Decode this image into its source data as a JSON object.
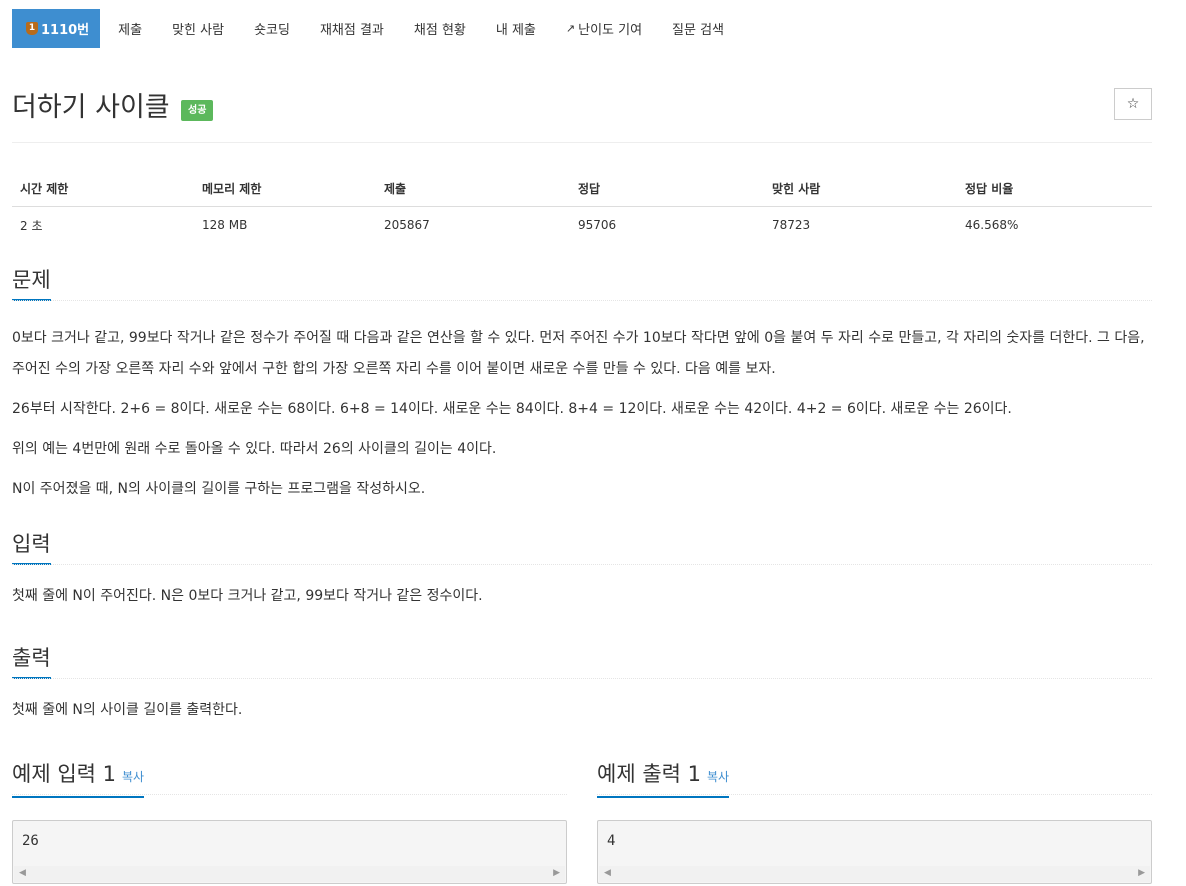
{
  "nav": {
    "problem_num": "1110번",
    "problem_badge_icon": "trophy-icon",
    "items": [
      "제출",
      "맞힌 사람",
      "숏코딩",
      "재채점 결과",
      "채점 현황",
      "내 제출",
      "난이도 기여",
      "질문 검색"
    ]
  },
  "problem": {
    "title": "더하기 사이클",
    "status_badge": "성공",
    "star": "☆"
  },
  "info": {
    "headers": [
      "시간 제한",
      "메모리 제한",
      "제출",
      "정답",
      "맞힌 사람",
      "정답 비율"
    ],
    "values": [
      "2 초",
      "128 MB",
      "205867",
      "95706",
      "78723",
      "46.568%"
    ]
  },
  "sections": {
    "description": {
      "heading": "문제",
      "paragraphs": [
        "0보다 크거나 같고, 99보다 작거나 같은 정수가 주어질 때 다음과 같은 연산을 할 수 있다. 먼저 주어진 수가 10보다 작다면 앞에 0을 붙여 두 자리 수로 만들고, 각 자리의 숫자를 더한다. 그 다음, 주어진 수의 가장 오른쪽 자리 수와 앞에서 구한 합의 가장 오른쪽 자리 수를 이어 붙이면 새로운 수를 만들 수 있다. 다음 예를 보자.",
        "26부터 시작한다. 2+6 = 8이다. 새로운 수는 68이다. 6+8 = 14이다. 새로운 수는 84이다. 8+4 = 12이다. 새로운 수는 42이다. 4+2 = 6이다. 새로운 수는 26이다.",
        "위의 예는 4번만에 원래 수로 돌아올 수 있다. 따라서 26의 사이클의 길이는 4이다.",
        "N이 주어졌을 때, N의 사이클의 길이를 구하는 프로그램을 작성하시오."
      ]
    },
    "input": {
      "heading": "입력",
      "text": "첫째 줄에 N이 주어진다. N은 0보다 크거나 같고, 99보다 작거나 같은 정수이다."
    },
    "output": {
      "heading": "출력",
      "text": "첫째 줄에 N의 사이클 길이를 출력한다."
    }
  },
  "samples": {
    "input": {
      "heading": "예제 입력 1",
      "copy": "복사",
      "content": "26"
    },
    "output": {
      "heading": "예제 출력 1",
      "copy": "복사",
      "content": "4"
    }
  },
  "colors": {
    "nav_active": "#3e8ed0",
    "badge_success": "#5cb85c",
    "heading_underline": "#0076c0"
  }
}
